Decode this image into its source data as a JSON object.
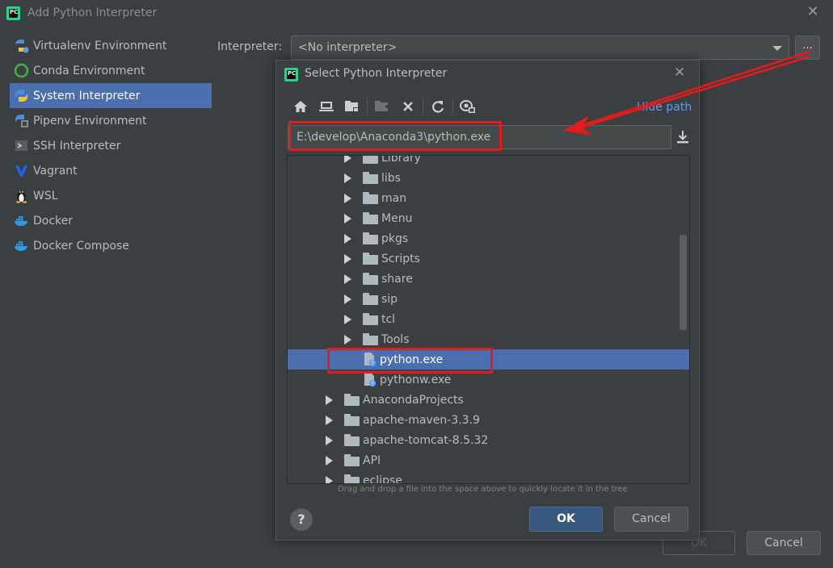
{
  "window": {
    "title": "Add Python Interpreter",
    "close_glyph": "✕"
  },
  "sidebar": {
    "items": [
      {
        "label": "Virtualenv Environment",
        "icon": "virtualenv-icon"
      },
      {
        "label": "Conda Environment",
        "icon": "conda-icon"
      },
      {
        "label": "System Interpreter",
        "icon": "python-icon",
        "selected": true
      },
      {
        "label": "Pipenv Environment",
        "icon": "pipenv-icon"
      },
      {
        "label": "SSH Interpreter",
        "icon": "ssh-icon"
      },
      {
        "label": "Vagrant",
        "icon": "vagrant-icon"
      },
      {
        "label": "WSL",
        "icon": "linux-icon"
      },
      {
        "label": "Docker",
        "icon": "docker-icon"
      },
      {
        "label": "Docker Compose",
        "icon": "docker-compose-icon"
      }
    ]
  },
  "interpreter": {
    "label": "Interpreter:",
    "value": "<No interpreter>",
    "browse_label": "..."
  },
  "footer": {
    "ok_label": "OK",
    "cancel_label": "Cancel"
  },
  "dialog": {
    "title": "Select Python Interpreter",
    "close_glyph": "✕",
    "hide_path_label": "Hide path",
    "path_value": "E:\\develop\\Anaconda3\\python.exe",
    "tree": {
      "rows": [
        {
          "label": "Library",
          "type": "folder",
          "depth": 2
        },
        {
          "label": "libs",
          "type": "folder",
          "depth": 2
        },
        {
          "label": "man",
          "type": "folder",
          "depth": 2
        },
        {
          "label": "Menu",
          "type": "folder",
          "depth": 2
        },
        {
          "label": "pkgs",
          "type": "folder",
          "depth": 2
        },
        {
          "label": "Scripts",
          "type": "folder",
          "depth": 2
        },
        {
          "label": "share",
          "type": "folder",
          "depth": 2
        },
        {
          "label": "sip",
          "type": "folder",
          "depth": 2
        },
        {
          "label": "tcl",
          "type": "folder",
          "depth": 2
        },
        {
          "label": "Tools",
          "type": "folder",
          "depth": 2
        },
        {
          "label": "python.exe",
          "type": "file",
          "depth": 2,
          "selected": true
        },
        {
          "label": "pythonw.exe",
          "type": "file",
          "depth": 2
        },
        {
          "label": "AnacondaProjects",
          "type": "folder",
          "depth": 1
        },
        {
          "label": "apache-maven-3.3.9",
          "type": "folder",
          "depth": 1
        },
        {
          "label": "apache-tomcat-8.5.32",
          "type": "folder",
          "depth": 1
        },
        {
          "label": "API",
          "type": "folder",
          "depth": 1
        },
        {
          "label": "eclipse",
          "type": "folder",
          "depth": 1
        }
      ]
    },
    "hint": "Drag and drop a file into the space above to quickly locate it in the tree",
    "help_label": "?",
    "ok_label": "OK",
    "cancel_label": "Cancel"
  },
  "colors": {
    "background": "#3c3f41",
    "selection": "#4b6eaf",
    "accent_link": "#589df6",
    "annotation_red": "#e41b1b"
  }
}
